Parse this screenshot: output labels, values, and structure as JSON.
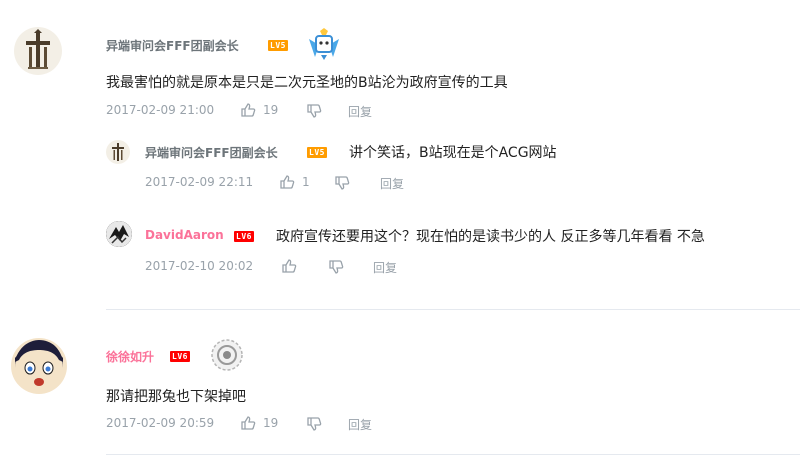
{
  "comments": [
    {
      "user": "异端审问会FFF团副会长",
      "level": "LV5",
      "text": "我最害怕的就是原本是只是二次元圣地的B站沦为政府宣传的工具",
      "time": "2017-02-09 21:00",
      "likes": "19",
      "reply_label": "回复",
      "replies": [
        {
          "user": "异端审问会FFF团副会长",
          "level": "LV5",
          "text": "讲个笑话，B站现在是个ACG网站",
          "time": "2017-02-09 22:11",
          "likes": "1",
          "reply_label": "回复"
        },
        {
          "user": "DavidAaron",
          "level": "LV6",
          "text": "政府宣传还要用这个？现在怕的是读书少的人 反正多等几年看看 不急",
          "time": "2017-02-10 20:02",
          "likes": "",
          "reply_label": "回复"
        }
      ]
    },
    {
      "user": "徐徐如升",
      "level": "LV6",
      "text": "那请把那兔也下架掉吧",
      "time": "2017-02-09 20:59",
      "likes": "19",
      "reply_label": "回复"
    }
  ],
  "icons": {
    "like": "thumbs-up-icon",
    "dislike": "thumbs-down-icon"
  },
  "colors": {
    "username": "#6d757a",
    "username_vip": "#fb7299",
    "meta": "#99a2aa",
    "level5": "#ff9c00",
    "level6": "#ff0000"
  }
}
